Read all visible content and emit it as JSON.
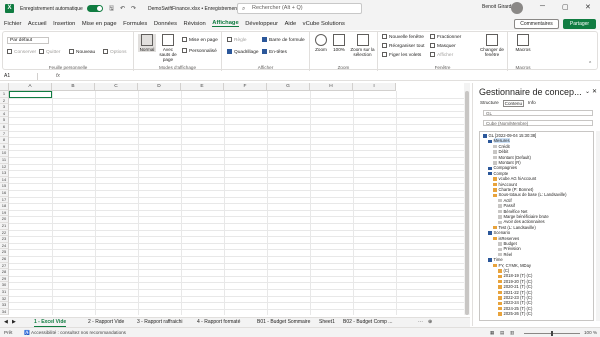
{
  "titlebar": {
    "autosave_label": "Enregistrement automatique",
    "doc_title": "DemoSwiftFinance.xlsx • Enregistrement en cours...",
    "search_placeholder": "Rechercher (Alt + Q)",
    "user_name": "Benoit Girard"
  },
  "menu": {
    "items": [
      "Fichier",
      "Accueil",
      "Insertion",
      "Mise en page",
      "Formules",
      "Données",
      "Révision",
      "Affichage",
      "Développeur",
      "Aide",
      "vCube Solutions"
    ],
    "active": "Affichage",
    "comments_label": "Commentaires",
    "share_label": "Partager"
  },
  "ribbon": {
    "view_select": "Par défaut",
    "keep": "Conserver",
    "exit": "Quitter",
    "new": "Nouveau",
    "options": "Options",
    "group_sheet_view": "Feuille personnelle",
    "normal": "Normal",
    "page_break": "Avec sauts de page",
    "page_layout": "Mise en page",
    "custom": "Personnalisé",
    "group_workbook_view": "Modes d'affichage",
    "ruler": "Règle",
    "formula_bar": "Barre de formule",
    "gridlines": "Quadrillage",
    "headings": "En-têtes",
    "group_show": "Afficher",
    "zoom": "Zoom",
    "zoom100": "100%",
    "zoom_selection": "Zoom sur la sélection",
    "group_zoom": "Zoom",
    "new_window": "Nouvelle fenêtre",
    "arrange_all": "Réorganiser tout",
    "freeze": "Figer les volets",
    "split": "Fractionner",
    "hide": "Masquer",
    "unhide": "Afficher",
    "switch_windows": "Changer de fenêtre",
    "group_window": "Fenêtre",
    "macros": "Macros",
    "group_macros": "Macros"
  },
  "formula_bar": {
    "name_box": "A1",
    "fx": "fx"
  },
  "grid": {
    "columns": [
      "A",
      "B",
      "C",
      "D",
      "E",
      "F",
      "G",
      "H",
      "I"
    ],
    "rows": [
      "1",
      "2",
      "3",
      "4",
      "5",
      "6",
      "7",
      "8",
      "9",
      "10",
      "11",
      "12",
      "13",
      "14",
      "15",
      "16",
      "17",
      "18",
      "19",
      "20",
      "21",
      "22",
      "23",
      "24",
      "25",
      "26",
      "27",
      "28",
      "29",
      "30",
      "31",
      "32",
      "33",
      "34"
    ]
  },
  "panel": {
    "title": "Gestionnaire de concep...",
    "tabs": [
      "Structure",
      "Contenu",
      "Info"
    ],
    "filter": "GL",
    "search_placeholder": "Cube (Nom/Membre)",
    "tree": [
      {
        "label": "GL [2022-09-04 15:30:38]",
        "level": 0,
        "color": "#2b579a"
      },
      {
        "label": "Mesures",
        "level": 1,
        "color": "#2b579a"
      },
      {
        "label": "Crédit",
        "level": 2,
        "color": "#c8c6c4"
      },
      {
        "label": "Débit",
        "level": 2,
        "color": "#c8c6c4"
      },
      {
        "label": "Montant (Default)",
        "level": 2,
        "color": "#c8c6c4"
      },
      {
        "label": "Montant (R)",
        "level": 2,
        "color": "#c8c6c4"
      },
      {
        "label": "Compagnies",
        "level": 1,
        "color": "#2b579a"
      },
      {
        "label": "Compte",
        "level": 1,
        "color": "#2b579a"
      },
      {
        "label": "vcube AG hiAccount",
        "level": 2,
        "color": "#e8a33c"
      },
      {
        "label": "hiAccount",
        "level": 2,
        "color": "#e8a33c"
      },
      {
        "label": "Charte (P: Bonnet)",
        "level": 2,
        "color": "#e8a33c"
      },
      {
        "label": "Sous-totaux de base (L: Landsaville)",
        "level": 2,
        "color": "#e8a33c"
      },
      {
        "label": "Actif",
        "level": 3,
        "color": "#c8c6c4"
      },
      {
        "label": "Passif",
        "level": 3,
        "color": "#c8c6c4"
      },
      {
        "label": "Bénéfice Net",
        "level": 3,
        "color": "#c8c6c4"
      },
      {
        "label": "Marge bénéficiaire brute",
        "level": 3,
        "color": "#c8c6c4"
      },
      {
        "label": "Avoir des actionnaires",
        "level": 3,
        "color": "#c8c6c4"
      },
      {
        "label": "Test (L: Landsaville)",
        "level": 2,
        "color": "#e8a33c"
      },
      {
        "label": "Scenario",
        "level": 1,
        "color": "#2b579a"
      },
      {
        "label": "isReserves",
        "level": 2,
        "color": "#e8a33c"
      },
      {
        "label": "Budget",
        "level": 3,
        "color": "#c8c6c4"
      },
      {
        "label": "Prévision",
        "level": 3,
        "color": "#c8c6c4"
      },
      {
        "label": "Réel",
        "level": 3,
        "color": "#c8c6c4"
      },
      {
        "label": "Time",
        "level": 1,
        "color": "#2b579a"
      },
      {
        "label": "FY, CYMK, MDay",
        "level": 2,
        "color": "#e8a33c"
      },
      {
        "label": "(C)",
        "level": 3,
        "color": "#e8a33c"
      },
      {
        "label": "2018-19 (T) (C)",
        "level": 3,
        "color": "#e8a33c"
      },
      {
        "label": "2019-20 (T) (C)",
        "level": 3,
        "color": "#e8a33c"
      },
      {
        "label": "2020-21 (T) (C)",
        "level": 3,
        "color": "#e8a33c"
      },
      {
        "label": "2021-22 (T) (C)",
        "level": 3,
        "color": "#e8a33c"
      },
      {
        "label": "2022-23 (T) (C)",
        "level": 3,
        "color": "#e8a33c"
      },
      {
        "label": "2023-24 (T) (C)",
        "level": 3,
        "color": "#e8a33c"
      },
      {
        "label": "2024-25 (T) (C)",
        "level": 3,
        "color": "#e8a33c"
      },
      {
        "label": "2025-26 (T) (C)",
        "level": 3,
        "color": "#e8a33c"
      }
    ]
  },
  "sheets": {
    "tabs": [
      "1 - Excel Vide",
      "2 - Rapport Vide",
      "3 - Rapport raffraichi",
      "4 - Rapport formaté",
      "B01 - Budget Sommaire",
      "Sheet1",
      "B02 - Budget Comp ..."
    ],
    "active_index": 0
  },
  "status": {
    "ready": "Prêt",
    "accessibility": "Accessibilité : consultez nos recommandations",
    "zoom": "100 %"
  },
  "colors": {
    "accent": "#107c41",
    "titlebar_bg": "#f3f3f3"
  }
}
